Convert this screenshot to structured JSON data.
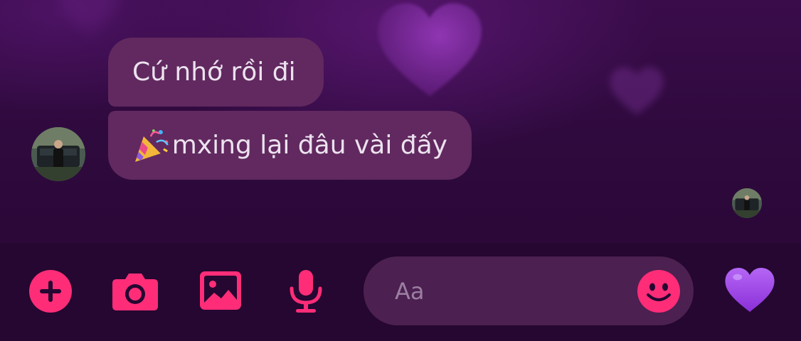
{
  "messages": [
    {
      "text": "Cứ nhớ rồi đi",
      "prefix_icon": null
    },
    {
      "text": "mxing lại đâu vài đấy",
      "prefix_icon": "party-popper-icon"
    }
  ],
  "composer": {
    "placeholder": "Aa",
    "actions": [
      "plus-icon",
      "camera-icon",
      "gallery-icon",
      "microphone-icon"
    ],
    "emoji_icon": "smiley-icon",
    "quick_reaction_icon": "purple-heart-icon"
  },
  "colors": {
    "accent": "#ff2d78",
    "bubble": "#61295f",
    "background": "#2a0834",
    "reaction_heart": "#a24fe8"
  }
}
